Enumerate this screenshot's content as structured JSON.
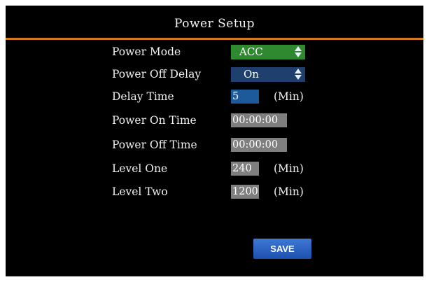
{
  "title": "Power Setup",
  "colors": {
    "accent_rule": "#d4791c",
    "green_spinner": "#2f8a2f",
    "blue_spinner": "#1f3f6e",
    "blue_field": "#1d5a9c",
    "gray_field": "#7f7f7f",
    "save_button": "#2a5fc4"
  },
  "rows": {
    "power_mode": {
      "label": "Power Mode",
      "value": "ACC",
      "icon": "up-down-arrows-icon"
    },
    "power_off_delay": {
      "label": "Power Off Delay",
      "value": "On",
      "icon": "up-down-arrows-icon"
    },
    "delay_time": {
      "label": "Delay Time",
      "value": "5",
      "unit": "(Min)"
    },
    "power_on_time": {
      "label": "Power On Time",
      "value": "00:00:00"
    },
    "power_off_time": {
      "label": "Power Off Time",
      "value": "00:00:00"
    },
    "level_one": {
      "label": "Level One",
      "value": "240",
      "unit": "(Min)"
    },
    "level_two": {
      "label": "Level Two",
      "value": "1200",
      "unit": "(Min)"
    }
  },
  "save_label": "SAVE"
}
